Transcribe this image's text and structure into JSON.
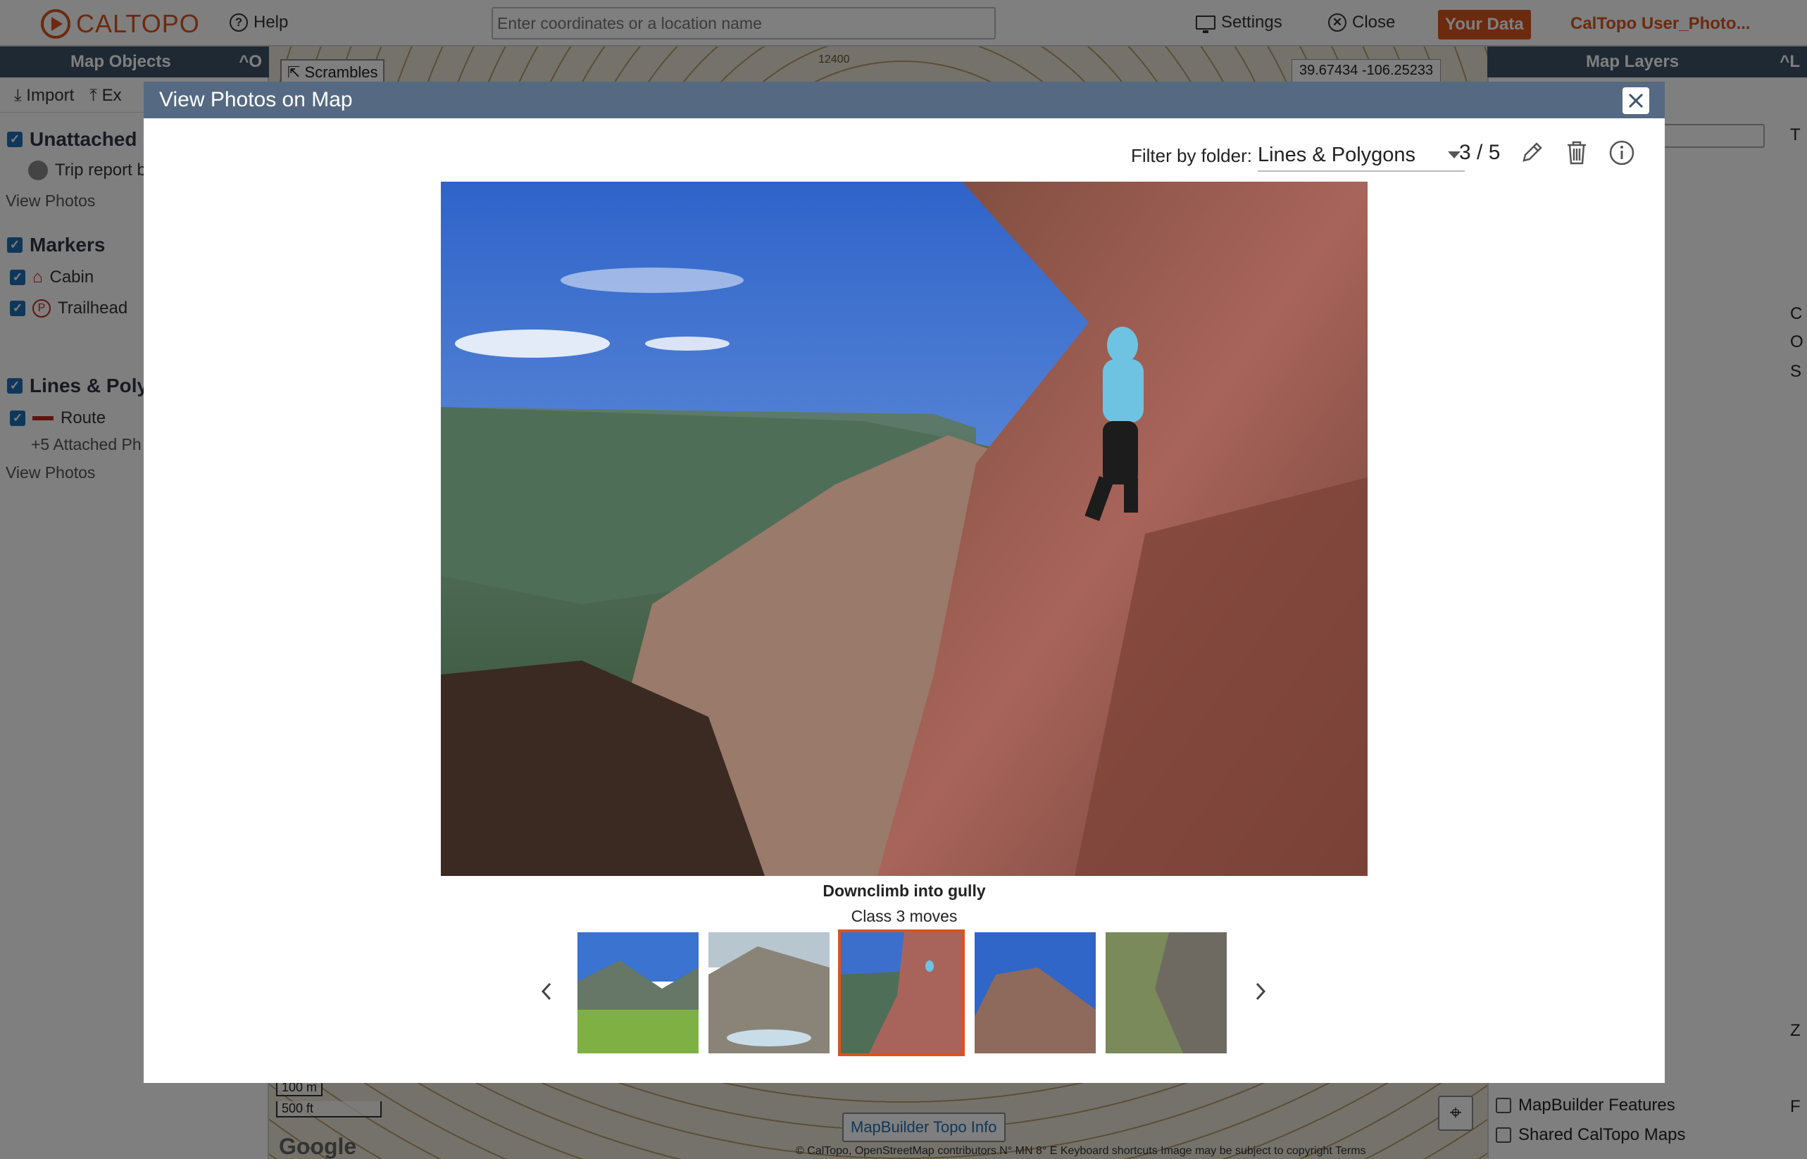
{
  "app": {
    "logo_text": "CALTOPO",
    "help_label": "Help",
    "search_placeholder": "Enter coordinates or a location name",
    "settings_label": "Settings",
    "close_label": "Close",
    "your_data_label": "Your Data",
    "user_label": "CalTopo User_Photo..."
  },
  "left_panel": {
    "title": "Map Objects",
    "shortcut": "^O",
    "import_label": "Import",
    "export_label": "Ex",
    "sections": {
      "unattached": {
        "title": "Unattached",
        "item": "Trip report b",
        "view_photos": "View Photos"
      },
      "markers": {
        "title": "Markers",
        "items": [
          "Cabin",
          "Trailhead"
        ]
      },
      "lines": {
        "title": "Lines & Poly",
        "item": "Route",
        "attached": "+5 Attached Ph",
        "view_photos": "View Photos"
      }
    }
  },
  "map": {
    "scrambles_label": "Scrambles",
    "contour_label": "12400",
    "coords": "39.67434 -106.25233",
    "scale_m": "100 m",
    "scale_ft": "500 ft",
    "info_label": "MapBuilder Topo Info",
    "attribution": "© CalTopo, OpenStreetMap contributors   N° MN 8° E   Keyboard shortcuts   Image may be subject to copyright   Terms",
    "google": "Google"
  },
  "right_panel": {
    "title": "Map Layers",
    "shortcut": "^L",
    "edge_letters": [
      "T",
      "C",
      "O",
      "S",
      "Z",
      "F"
    ],
    "mapbuilder_features": "MapBuilder Features",
    "shared_maps": "Shared CalTopo Maps"
  },
  "modal": {
    "title": "View Photos on Map",
    "filter_label": "Filter by folder:",
    "folder_value": "Lines & Polygons",
    "counter": "3 / 5",
    "photo_title": "Downclimb into gully",
    "photo_caption": "Class 3 moves",
    "thumb_count": 5,
    "active_index": 3
  }
}
